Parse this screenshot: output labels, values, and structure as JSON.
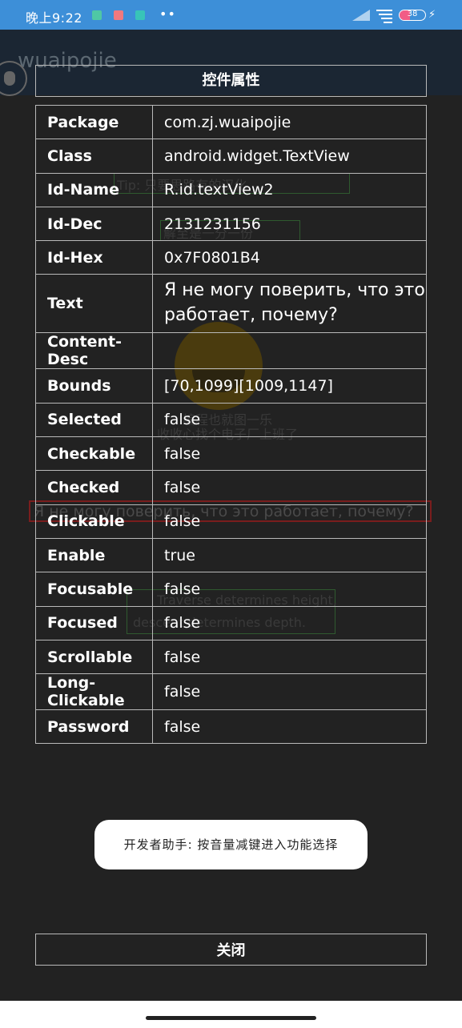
{
  "status_bar": {
    "time": "晚上9:22",
    "dots": "••",
    "battery": "38",
    "icons": [
      "app-green-icon",
      "app-red-icon",
      "app-teal-icon",
      "signal-icon",
      "net-icon",
      "battery-icon",
      "charging-bolt-icon"
    ],
    "colors": {
      "bar": "#3d8fd8",
      "battery_fill": "#f25c86"
    }
  },
  "background_app": {
    "title": "wuaipojie",
    "tip": "Tip: 只要思路有的汉化",
    "green_label": "解至是一分一份",
    "line1": "编程也就图一乐",
    "line2": "收收心找个电子厂上班了",
    "red_text": "Я не могу поверить, что это работает, почему?",
    "green_text_1": "Traverse determines height,",
    "green_text_2": "descent determines depth."
  },
  "dialog": {
    "title": "控件属性",
    "rows": [
      {
        "key": "Package",
        "value": "com.zj.wuaipojie"
      },
      {
        "key": "Class",
        "value": "android.widget.TextView"
      },
      {
        "key": "Id-Name",
        "value": "R.id.textView2"
      },
      {
        "key": "Id-Dec",
        "value": "2131231156"
      },
      {
        "key": "Id-Hex",
        "value": "0x7F0801B4"
      },
      {
        "key": "Text",
        "value": "Я не могу поверить, что это работает, почему?"
      },
      {
        "key": "Content-Desc",
        "value": ""
      },
      {
        "key": "Bounds",
        "value": "[70,1099][1009,1147]"
      },
      {
        "key": "Selected",
        "value": "false"
      },
      {
        "key": "Checkable",
        "value": "false"
      },
      {
        "key": "Checked",
        "value": "false"
      },
      {
        "key": "Clickable",
        "value": "false"
      },
      {
        "key": "Enable",
        "value": "true"
      },
      {
        "key": "Focusable",
        "value": "false"
      },
      {
        "key": "Focused",
        "value": "false"
      },
      {
        "key": "Scrollable",
        "value": "false"
      },
      {
        "key": "Long-Clickable",
        "value": "false"
      },
      {
        "key": "Password",
        "value": "false"
      }
    ],
    "close_label": "关闭"
  },
  "toast": {
    "text": "开发者助手: 按音量减键进入功能选择"
  }
}
